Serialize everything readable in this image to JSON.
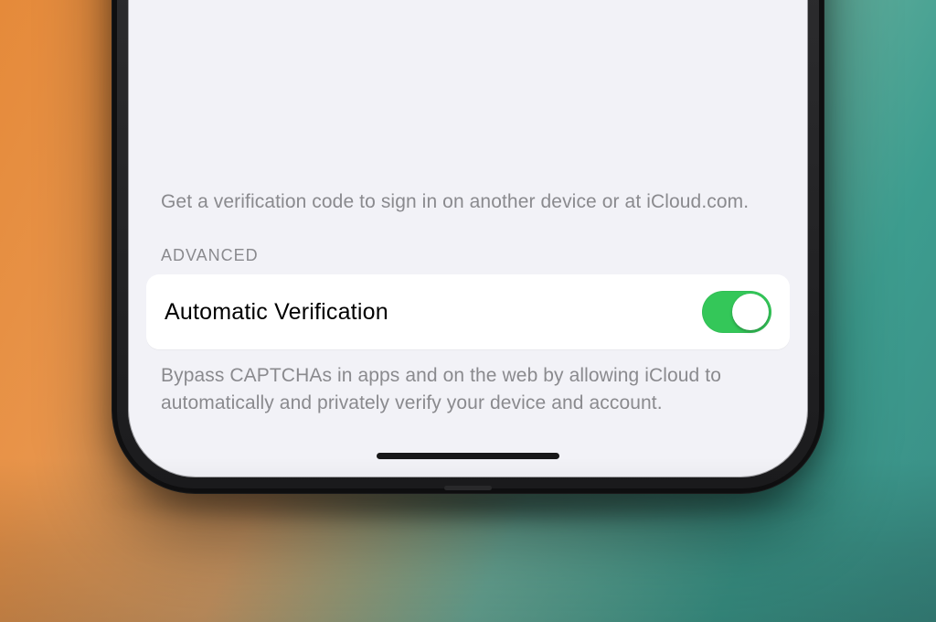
{
  "settings": {
    "prev_section_footer": "Get a verification code to sign in on another device or at iCloud.com.",
    "advanced": {
      "header": "ADVANCED",
      "automatic_verification": {
        "label": "Automatic Verification",
        "enabled": true
      },
      "footer": "Bypass CAPTCHAs in apps and on the web by allowing iCloud to automatically and privately verify your device and account."
    }
  },
  "colors": {
    "toggle_on": "#34c759",
    "ios_bg": "#f2f2f7"
  }
}
